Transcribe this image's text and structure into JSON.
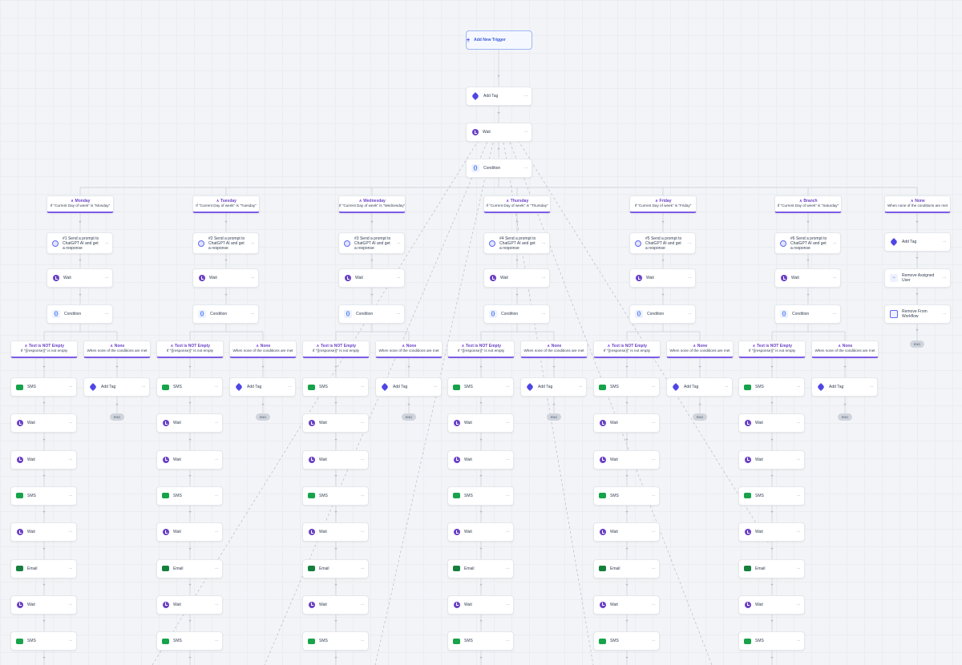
{
  "trigger": {
    "label": "Add New Trigger"
  },
  "main": [
    {
      "type": "tag",
      "label": "Add Tag"
    },
    {
      "type": "wait",
      "label": "Wait"
    },
    {
      "type": "cond",
      "label": "Condition"
    }
  ],
  "days": [
    {
      "title": "Monday",
      "sub": "If \"Current Day of week\" is \"Monday\"",
      "gpt": "#1 Send a prompt to ChatGPT AI and get a response"
    },
    {
      "title": "Tuesday",
      "sub": "If \"Current Day of week\" is \"Tuesday\"",
      "gpt": "#2 Send a prompt to ChatGPT AI and get a response"
    },
    {
      "title": "Wednesday",
      "sub": "If \"Current Day of week\" is \"Wednesday\"",
      "gpt": "#3 Send a prompt to ChatGPT AI and get a response"
    },
    {
      "title": "Thursday",
      "sub": "If \"Current Day of week\" is \"Thursday\"",
      "gpt": "#4 Send a prompt to ChatGPT AI and get a response"
    },
    {
      "title": "Friday",
      "sub": "If \"Current Day of week\" is \"Friday\"",
      "gpt": "#5 Send a prompt to ChatGPT AI and get a response"
    },
    {
      "title": "Branch",
      "sub": "If \"Current Day of week\" is \"Saturday\"",
      "gpt": "#6 Send a prompt to ChatGPT AI and get a response"
    }
  ],
  "none_branch": {
    "title": "None",
    "sub": "When none of the conditions are met"
  },
  "none_steps": [
    {
      "type": "tag",
      "label": "Add Tag"
    },
    {
      "type": "user",
      "label": "Remove Assigned User"
    },
    {
      "type": "remove",
      "label": "Remove From Workflow"
    }
  ],
  "day_steps": [
    {
      "type": "wait",
      "label": "Wait"
    },
    {
      "type": "cond",
      "label": "Condition"
    }
  ],
  "sub_branches": {
    "text_title": "Text is NOT Empty",
    "text_sub": "If \"{{response}}\" is not empty",
    "none_title": "None",
    "none_sub": "When none of the conditions are met"
  },
  "left_steps": [
    {
      "type": "sms",
      "label": "SMS"
    },
    {
      "type": "wait",
      "label": "Wait"
    },
    {
      "type": "wait",
      "label": "Wait"
    },
    {
      "type": "sms",
      "label": "SMS"
    },
    {
      "type": "wait",
      "label": "Wait"
    },
    {
      "type": "email",
      "label": "Email"
    },
    {
      "type": "wait",
      "label": "Wait"
    },
    {
      "type": "sms",
      "label": "SMS"
    }
  ],
  "right_step": {
    "type": "tag",
    "label": "Add Tag"
  },
  "end_label": "END",
  "more_glyph": "···",
  "plus_glyph": "+",
  "colors": {
    "accent": "#7c5ce6",
    "link": "#3b5bdb",
    "wait": "#6941c6",
    "sms": "#16a34a"
  }
}
